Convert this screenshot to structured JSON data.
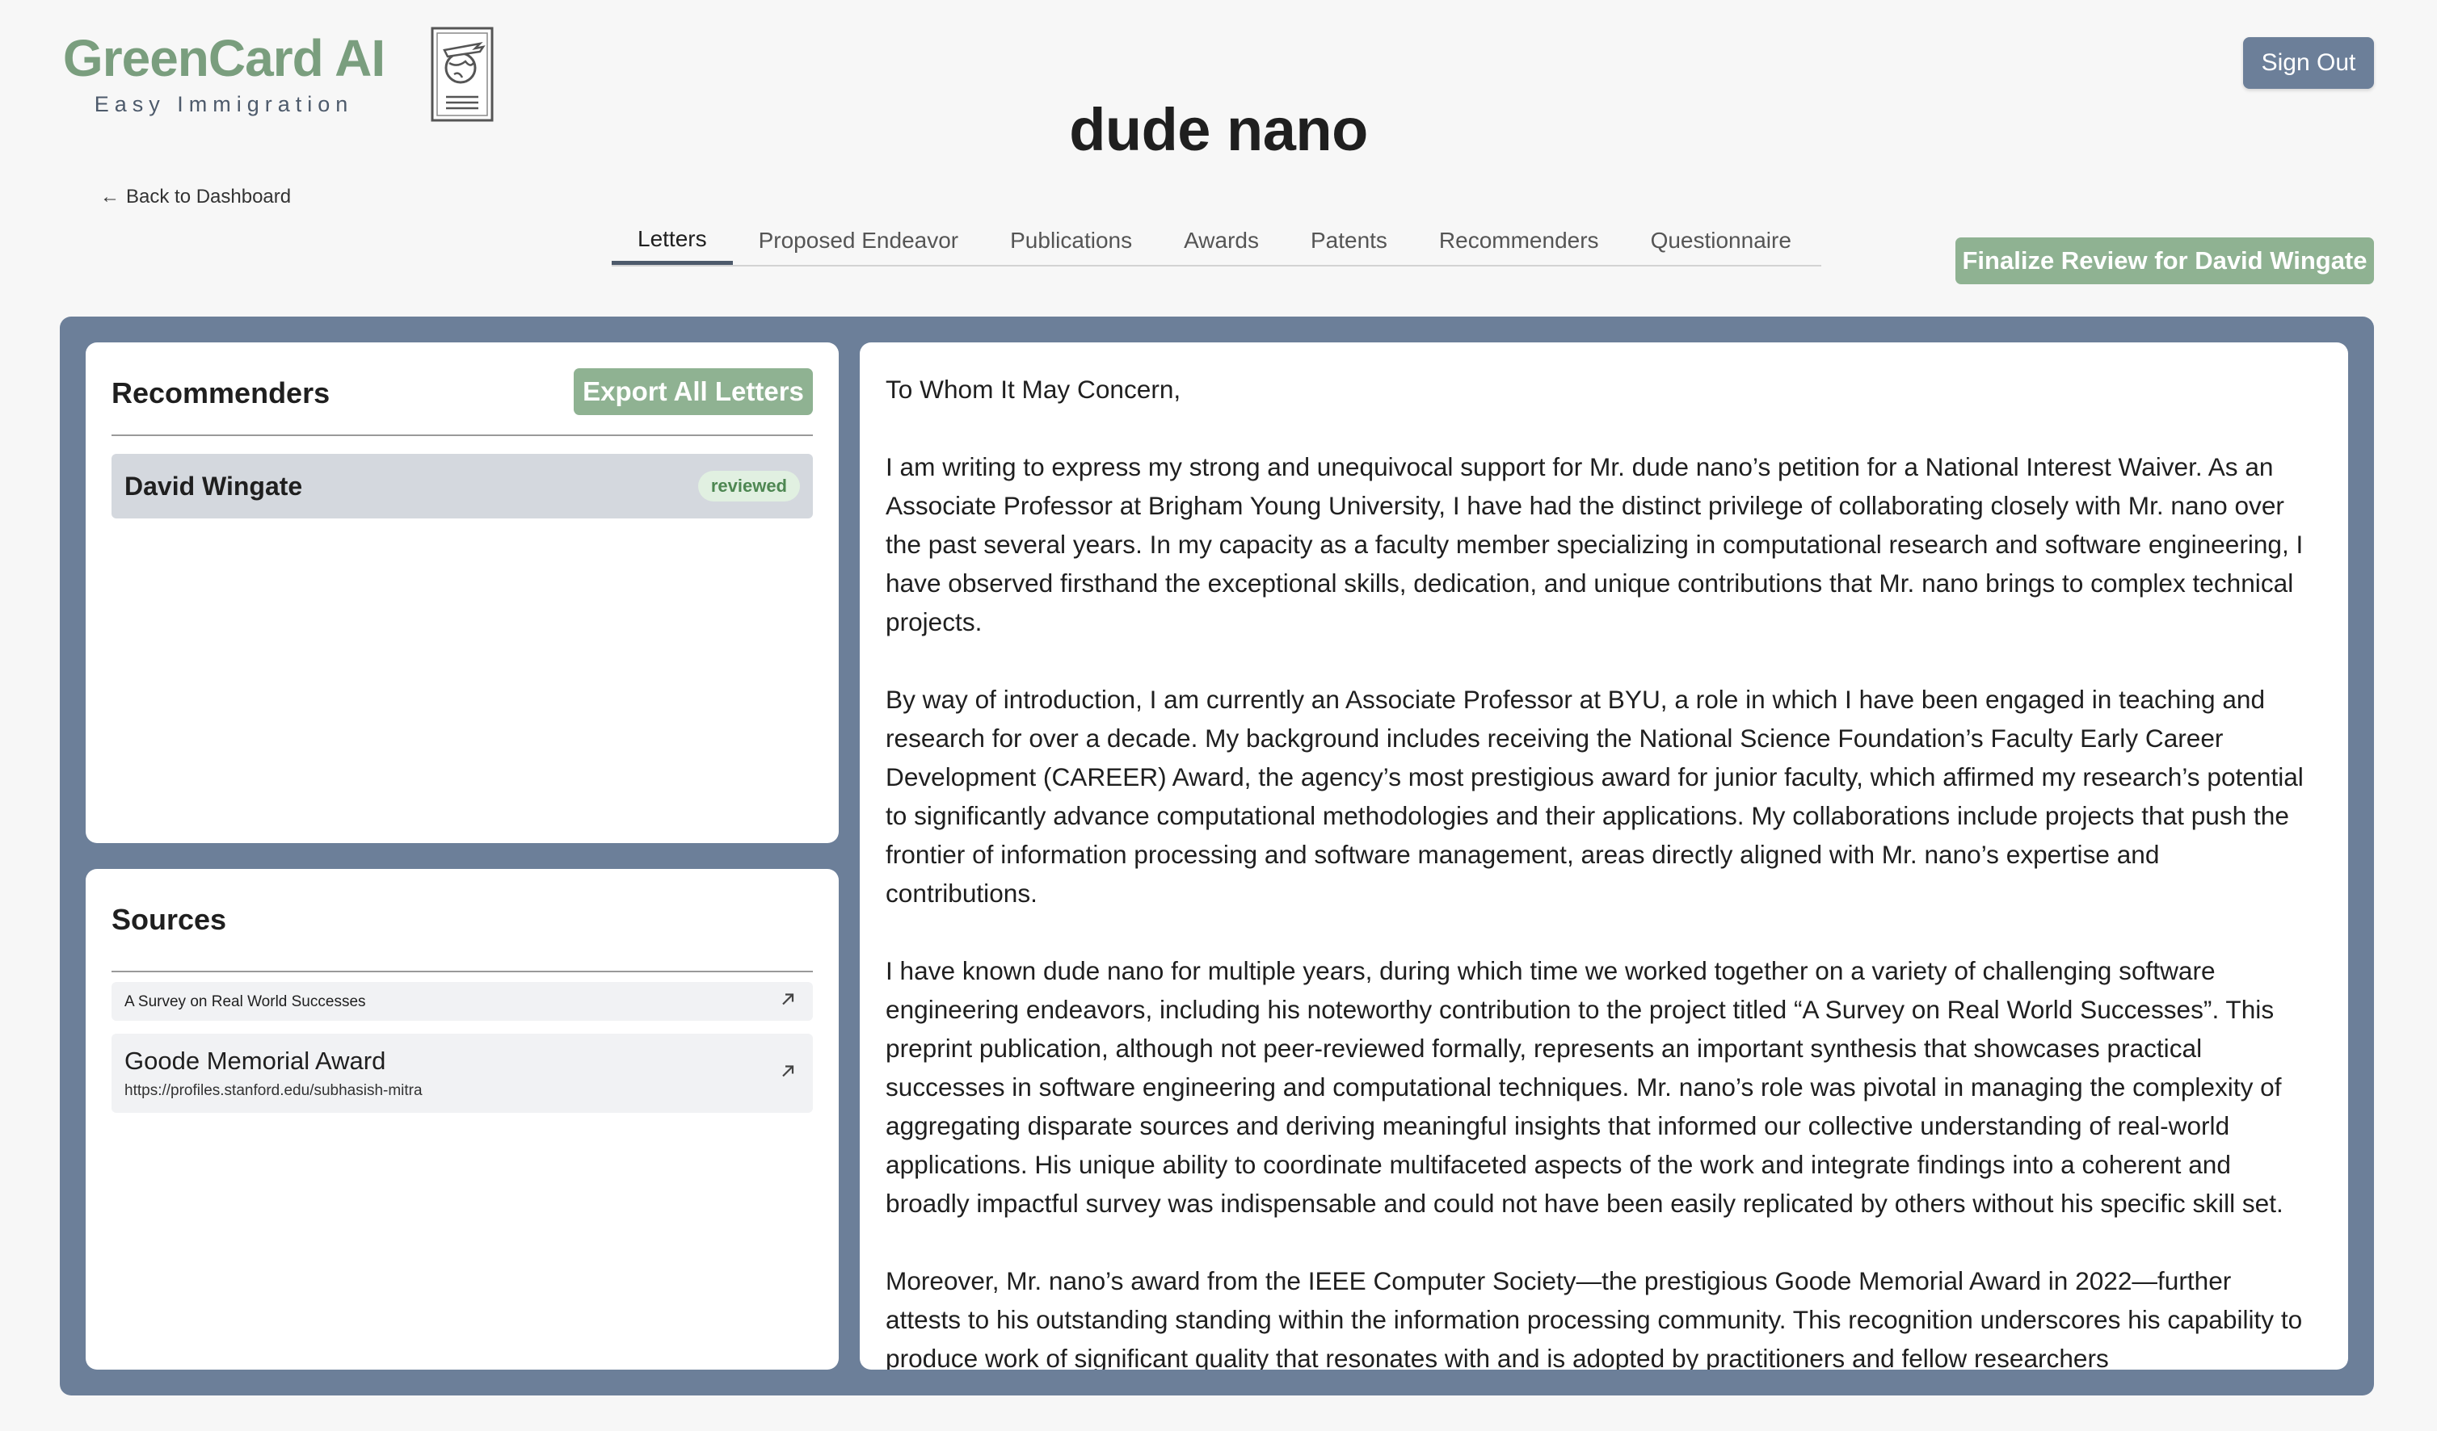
{
  "logo": {
    "title": "GreenCard AI",
    "subtitle": "Easy Immigration",
    "icon": "passport-globe-icon"
  },
  "header": {
    "title": "dude nano",
    "sign_out": "Sign Out",
    "back": "Back to Dashboard"
  },
  "tabs": [
    {
      "label": "Letters",
      "active": true
    },
    {
      "label": "Proposed Endeavor",
      "active": false
    },
    {
      "label": "Publications",
      "active": false
    },
    {
      "label": "Awards",
      "active": false
    },
    {
      "label": "Patents",
      "active": false
    },
    {
      "label": "Recommenders",
      "active": false
    },
    {
      "label": "Questionnaire",
      "active": false
    }
  ],
  "finalize_label": "Finalize Review for David Wingate",
  "recommenders": {
    "title": "Recommenders",
    "export_label": "Export All Letters",
    "items": [
      {
        "name": "David Wingate",
        "status": "reviewed"
      }
    ]
  },
  "sources": {
    "title": "Sources",
    "items": [
      {
        "title": "A Survey on Real World Successes",
        "url": ""
      },
      {
        "title": "Goode Memorial Award",
        "url": "https://profiles.stanford.edu/subhasish-mitra"
      }
    ]
  },
  "letter": {
    "paragraphs": [
      "To Whom It May Concern,",
      "I am writing to express my strong and unequivocal support for Mr. dude nano’s petition for a National Interest Waiver. As an Associate Professor at Brigham Young University, I have had the distinct privilege of collaborating closely with Mr. nano over the past several years. In my capacity as a faculty member specializing in computational research and software engineering, I have observed firsthand the exceptional skills, dedication, and unique contributions that Mr. nano brings to complex technical projects.",
      "By way of introduction, I am currently an Associate Professor at BYU, a role in which I have been engaged in teaching and research for over a decade. My background includes receiving the National Science Foundation’s Faculty Early Career Development (CAREER) Award, the agency’s most prestigious award for junior faculty, which affirmed my research’s potential to significantly advance computational methodologies and their applications. My collaborations include projects that push the frontier of information processing and software management, areas directly aligned with Mr. nano’s expertise and contributions.",
      "I have known dude nano for multiple years, during which time we worked together on a variety of challenging software engineering endeavors, including his noteworthy contribution to the project titled “A Survey on Real World Successes”. This preprint publication, although not peer-reviewed formally, represents an important synthesis that showcases practical successes in software engineering and computational techniques. Mr. nano’s role was pivotal in managing the complexity of aggregating disparate sources and deriving meaningful insights that informed our collective understanding of real-world applications. His unique ability to coordinate multifaceted aspects of the work and integrate findings into a coherent and broadly impactful survey was indispensable and could not have been easily replicated by others without his specific skill set.",
      "Moreover, Mr. nano’s award from the IEEE Computer Society—the prestigious Goode Memorial Award in 2022—further attests to his outstanding standing within the information processing community. This recognition underscores his capability to produce work of significant quality that resonates with and is adopted by practitioners and fellow researchers"
    ]
  },
  "colors": {
    "brand_green": "#7a9e7e",
    "button_green": "#8fb292",
    "slate": "#6c7f99",
    "badge_text": "#4e8752"
  }
}
